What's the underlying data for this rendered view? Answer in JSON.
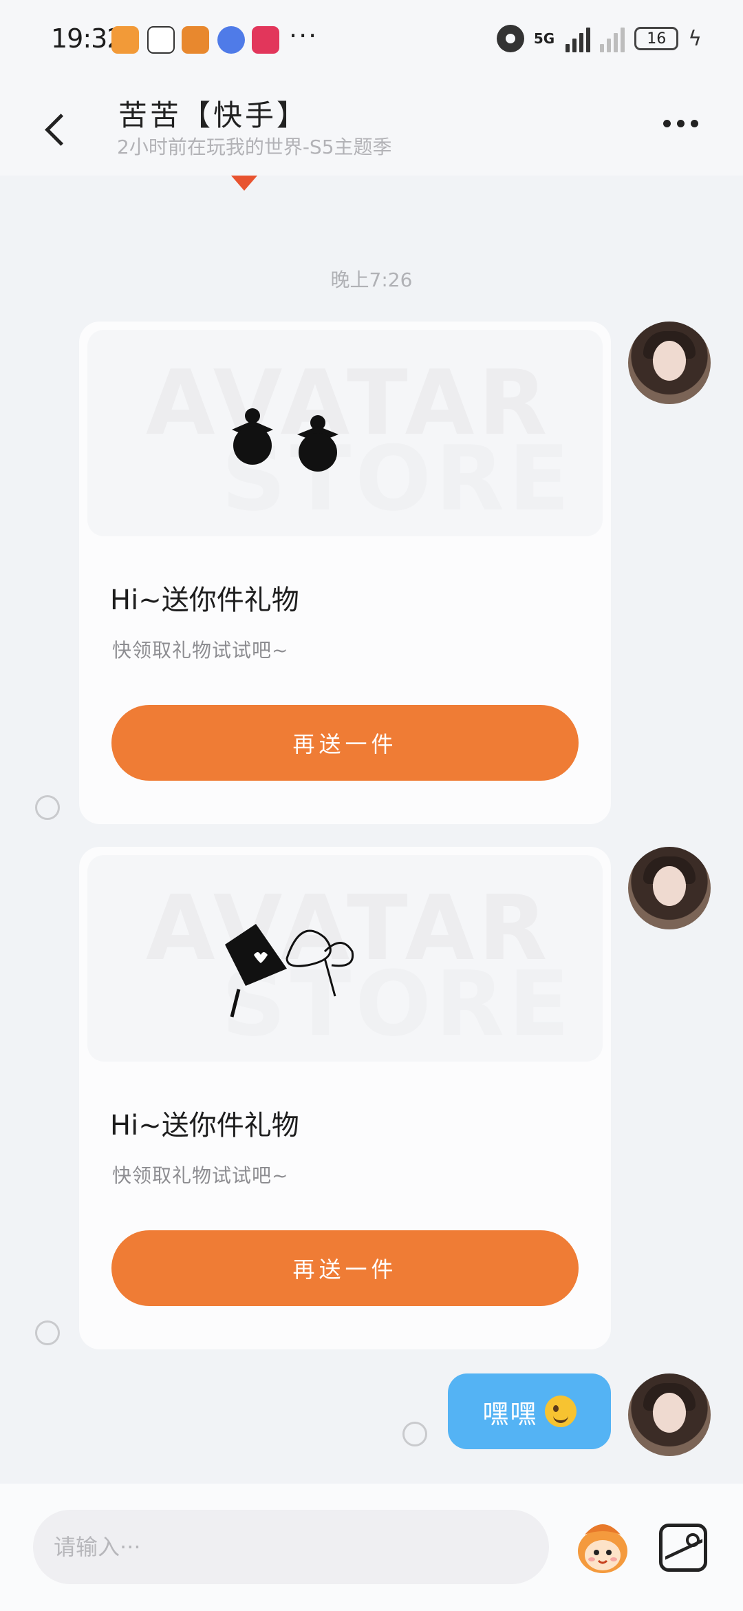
{
  "status_bar": {
    "time": "19:32",
    "network": "5G",
    "battery": "16"
  },
  "header": {
    "title": "苦苦【快手】",
    "subtitle": "2小时前在玩我的世界-S5主题季"
  },
  "chat": {
    "timestamp": "晚上7:26",
    "messages": [
      {
        "type": "gift",
        "watermark_line1": "AVATAR",
        "watermark_line2": "STORE",
        "title": "Hi~送你件礼物",
        "desc": "快领取礼物试试吧~",
        "button": "再送一件",
        "icon": "earrings-icon"
      },
      {
        "type": "gift",
        "watermark_line1": "AVATAR",
        "watermark_line2": "STORE",
        "title": "Hi~送你件礼物",
        "desc": "快领取礼物试试吧~",
        "button": "再送一件",
        "icon": "hair-clip-icon"
      },
      {
        "type": "text",
        "text": "嘿嘿",
        "emoji": "wink-emoji"
      }
    ]
  },
  "input": {
    "placeholder": "请输入···"
  },
  "colors": {
    "accent_orange": "#ef7c35",
    "bubble_blue": "#54b3f4",
    "background": "#f1f3f6"
  }
}
